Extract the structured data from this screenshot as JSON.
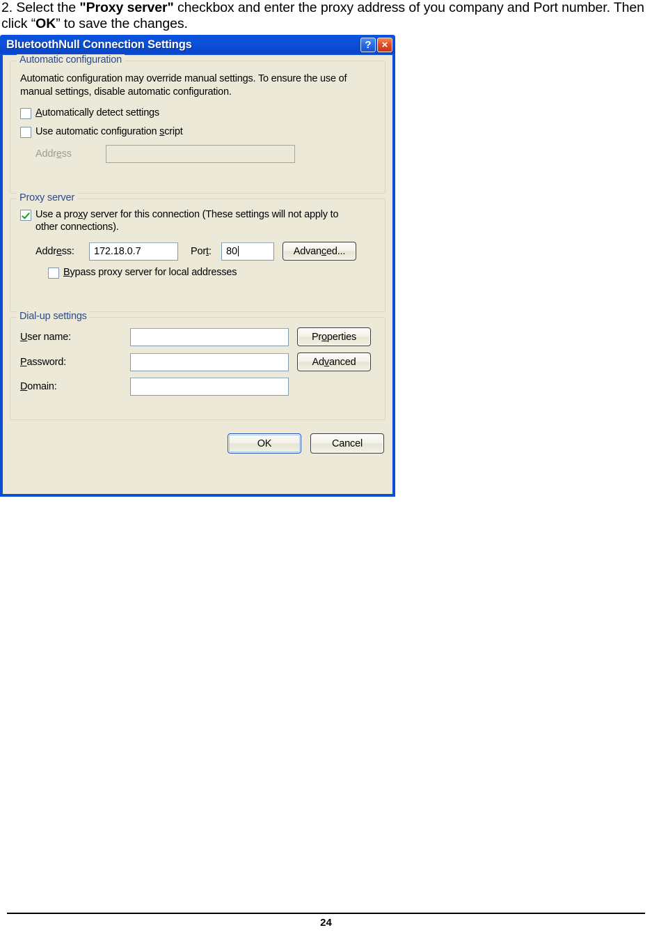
{
  "instructions": {
    "prefix": "2. Select the ",
    "bold1": "\"Proxy server\"",
    "middle": " checkbox and enter the proxy address of you company and Port number. Then click “",
    "bold2": "OK",
    "suffix": "” to save the changes."
  },
  "dialog": {
    "title": "BluetoothNull Connection Settings",
    "help_button": "?",
    "close_button": "×",
    "automatic_configuration": {
      "legend": "Automatic configuration",
      "description": "Automatic configuration may override manual settings.  To ensure the use of manual settings, disable automatic configuration.",
      "auto_detect": {
        "label_pre": "",
        "label_accel": "A",
        "label_post": "utomatically detect settings",
        "checked": false
      },
      "auto_script": {
        "label_pre": "Use automatic configuration ",
        "label_accel": "s",
        "label_post": "cript",
        "checked": false
      },
      "address_label_pre": "Addr",
      "address_label_accel": "e",
      "address_label_post": "ss",
      "address_value": ""
    },
    "proxy_server": {
      "legend": "Proxy server",
      "use_proxy": {
        "label_pre": "Use a pro",
        "label_accel": "x",
        "label_post": "y server for this connection (These settings will not apply to other connections).",
        "checked": true
      },
      "address_label_pre": "Addr",
      "address_label_accel": "e",
      "address_label_post": "ss:",
      "address_value": "172.18.0.7",
      "port_label_pre": "Por",
      "port_label_accel": "t",
      "port_label_post": ":",
      "port_value": "80",
      "advanced_button_pre": "Advan",
      "advanced_button_accel": "c",
      "advanced_button_post": "ed...",
      "bypass": {
        "label_pre": "",
        "label_accel": "B",
        "label_post": "ypass proxy server for local addresses",
        "checked": false
      }
    },
    "dialup_settings": {
      "legend": "Dial-up settings",
      "username_label_pre": "",
      "username_label_accel": "U",
      "username_label_post": "ser name:",
      "username_value": "",
      "password_label_pre": "",
      "password_label_accel": "P",
      "password_label_post": "assword:",
      "password_value": "",
      "domain_label_pre": "",
      "domain_label_accel": "D",
      "domain_label_post": "omain:",
      "domain_value": "",
      "properties_button_pre": "Pr",
      "properties_button_accel": "o",
      "properties_button_post": "perties",
      "advanced_button_pre": "Ad",
      "advanced_button_accel": "v",
      "advanced_button_post": "anced"
    },
    "ok_button": "OK",
    "cancel_button": "Cancel"
  },
  "footer": {
    "page_number": "24"
  },
  "colors": {
    "titlebar_blue": "#0A4FD4",
    "dialog_bg": "#ECE9D8",
    "legend_blue": "#2B4B8C",
    "check_green": "#18A018",
    "close_red": "#E2512B"
  }
}
